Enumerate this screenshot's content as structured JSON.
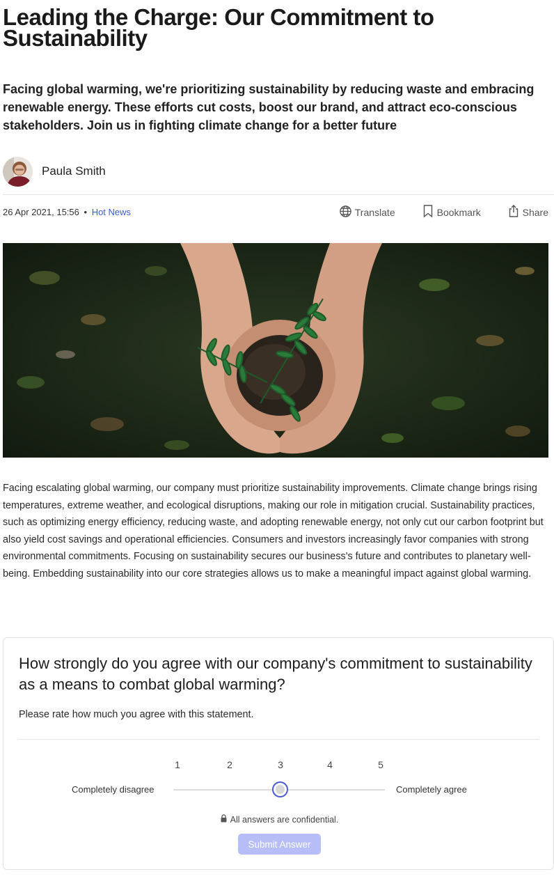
{
  "article": {
    "title": "Leading the Charge: Our Commitment to Sustainability",
    "subtitle": "Facing global warming, we're prioritizing sustainability by reducing waste and embracing renewable energy. These efforts cut costs, boost our brand, and attract eco-conscious stakeholders. Join us in fighting climate change for a better future",
    "author": {
      "name": "Paula Smith",
      "avatar_icon": "avatar-photo"
    },
    "meta": {
      "date": "26 Apr 2021, 15:56",
      "separator": "•",
      "category": "Hot News",
      "category_color": "#3a5bd9"
    },
    "actions": [
      {
        "label": "Translate",
        "icon": "globe-icon"
      },
      {
        "label": "Bookmark",
        "icon": "bookmark-icon"
      },
      {
        "label": "Share",
        "icon": "share-icon"
      }
    ],
    "body": "Facing escalating global warming, our company must prioritize sustainability improvements. Climate change brings rising temperatures, extreme weather, and ecological disruptions, making our role in mitigation crucial. Sustainability practices, such as optimizing energy efficiency, reducing waste, and adopting renewable energy, not only cut our carbon footprint but also yield cost savings and operational efficiencies. Consumers and investors increasingly favor companies with strong environmental commitments. Focusing on sustainability secures our business's future and contributes to planetary well-being. Embedding sustainability into our core strategies allows us to make a meaningful impact against global warming."
  },
  "survey": {
    "question": "How strongly do you agree with our company's commitment to sustainability as a means to combat global warming?",
    "instruction": "Please rate how much you agree with this statement.",
    "scale": {
      "numbers": [
        "1",
        "2",
        "3",
        "4",
        "5"
      ],
      "min_label": "Completely disagree",
      "max_label": "Completely agree",
      "selected_value": 3
    },
    "confidential_note": "All answers are confidential.",
    "confidential_icon": "lock-icon",
    "submit_label": "Submit Answer",
    "accent_color": "#4b5bd4",
    "submit_color": "#b6bdf7"
  }
}
